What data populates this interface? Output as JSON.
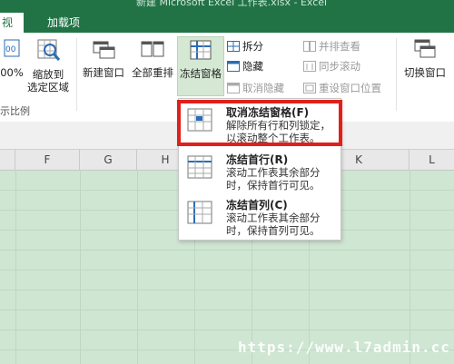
{
  "window": {
    "title": "新建 Microsoft Excel 工作表.xlsx - Excel"
  },
  "tabs": [
    {
      "label": "视图"
    },
    {
      "label": "加载项"
    }
  ],
  "ribbon": {
    "zoom_partial": "00%",
    "zoom_to_selection": "缩放到\n选定区域",
    "new_window": "新建窗口",
    "arrange_all": "全部重排",
    "freeze_panes": "冻结窗格",
    "split": "拆分",
    "hide": "隐藏",
    "unhide": "取消隐藏",
    "view_side_by_side": "并排查看",
    "sync_scroll": "同步滚动",
    "reset_window_position": "重设窗口位置",
    "switch_windows": "切换窗口",
    "zoom_group_label": "示比例"
  },
  "columns": [
    "F",
    "G",
    "H",
    "I",
    "J",
    "K",
    "L"
  ],
  "menu": {
    "items": [
      {
        "title": "取消冻结窗格(F)",
        "desc": "解除所有行和列锁定，以滚动整个工作表。"
      },
      {
        "title": "冻结首行(R)",
        "desc": "滚动工作表其余部分时，保持首行可见。"
      },
      {
        "title": "冻结首列(C)",
        "desc": "滚动工作表其余部分时，保持首列可见。"
      }
    ]
  },
  "watermark": "https://www.l7admin.cc",
  "colors": {
    "excel_green": "#217346",
    "highlight_red": "#e0201a",
    "sheet_bg": "#cfe6d3"
  }
}
